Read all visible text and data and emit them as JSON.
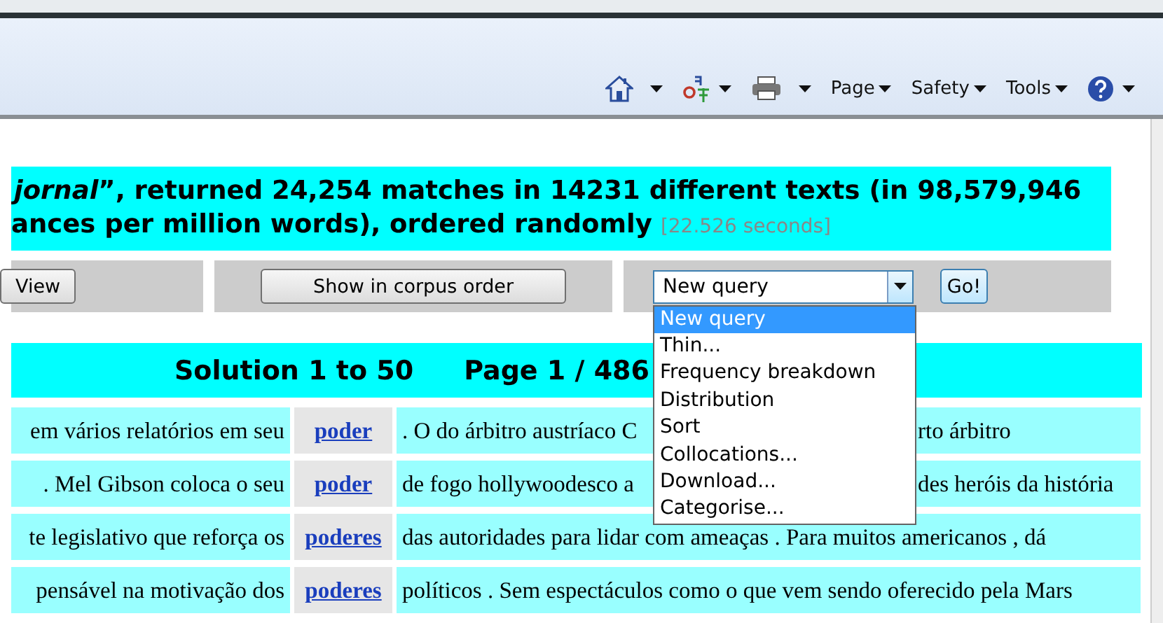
{
  "toolbar": {
    "items": [
      {
        "kind": "home"
      },
      {
        "kind": "translate"
      },
      {
        "kind": "print"
      },
      {
        "kind": "menu",
        "label": "Page"
      },
      {
        "kind": "menu",
        "label": "Safety"
      },
      {
        "kind": "menu",
        "label": "Tools"
      },
      {
        "kind": "help"
      }
    ]
  },
  "summary": {
    "line_1": "*jornal*”, returned 24,254 matches in 14231 different texts (in 98,579,946",
    "line_2": "ances per million words), ordered randomly",
    "timing": "[22.526 seconds]"
  },
  "controls": {
    "view_button": "View",
    "corpus_order_button": "Show in corpus order",
    "query_select": {
      "value": "New query",
      "expanded": true,
      "options": [
        {
          "label": "New query",
          "selected": true
        },
        {
          "label": "Thin...",
          "selected": false
        },
        {
          "label": "Frequency breakdown",
          "selected": false
        },
        {
          "label": "Distribution",
          "selected": false
        },
        {
          "label": "Sort",
          "selected": false
        },
        {
          "label": "Collocations...",
          "selected": false
        },
        {
          "label": "Download...",
          "selected": false
        },
        {
          "label": "Categorise...",
          "selected": false
        }
      ]
    },
    "go_button": "Go!"
  },
  "results_header": {
    "solution": "Solution 1 to 50",
    "page": "Page 1 / 486"
  },
  "rows": [
    {
      "left": "em vários relatórios em seu",
      "node": "poder",
      "right": ". O do árbitro austríaco C",
      "right_after": "rto árbitro"
    },
    {
      "left": ". Mel Gibson coloca o seu",
      "node": "poder",
      "right": "de fogo hollywoodesco a",
      "right_after": "des heróis da história"
    },
    {
      "left": "te legislativo que reforça os",
      "node": "poderes",
      "right": "das autoridades para lidar com ameaças . Para muitos americanos , dá"
    },
    {
      "left": "pensável na motivação dos",
      "node": "poderes",
      "right": "políticos . Sem espectáculos como o que vem sendo oferecido pela Mars"
    }
  ]
}
